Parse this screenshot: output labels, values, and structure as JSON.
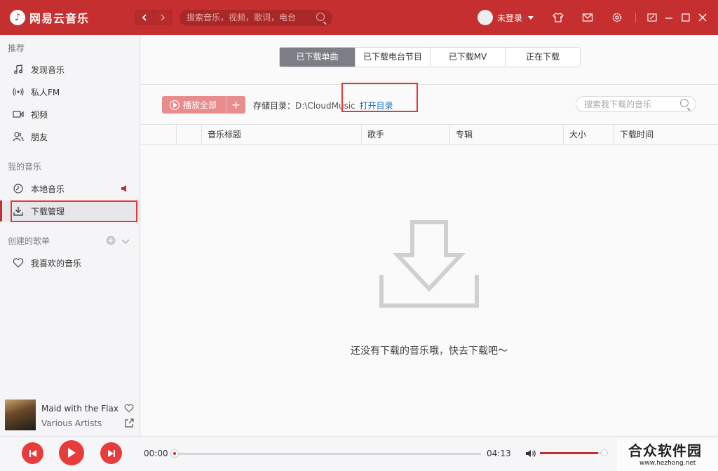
{
  "app": {
    "title": "网易云音乐"
  },
  "titlebar": {
    "search_placeholder": "搜索音乐，视频，歌词，电台",
    "user_label": "未登录"
  },
  "sidebar": {
    "recommend_title": "推荐",
    "recommend_items": [
      {
        "label": "发现音乐",
        "icon": "music-note-icon"
      },
      {
        "label": "私人FM",
        "icon": "radio-icon"
      },
      {
        "label": "视频",
        "icon": "video-icon"
      },
      {
        "label": "朋友",
        "icon": "friends-icon"
      }
    ],
    "my_music_title": "我的音乐",
    "my_music_items": [
      {
        "label": "本地音乐",
        "icon": "clock-icon"
      },
      {
        "label": "下载管理",
        "icon": "download-icon",
        "active": true
      }
    ],
    "created_title": "创建的歌单",
    "created_items": [
      {
        "label": "我喜欢的音乐",
        "icon": "heart-icon"
      }
    ]
  },
  "now_playing": {
    "title": "Maid with the Flax...",
    "artist": "Various Artists"
  },
  "tabs": [
    {
      "label": "已下载单曲",
      "active": true
    },
    {
      "label": "已下载电台节目"
    },
    {
      "label": "已下载MV"
    },
    {
      "label": "正在下载"
    }
  ],
  "toolbar": {
    "play_all": "播放全部",
    "plus": "+",
    "storage_label": "存储目录：",
    "storage_path": "D:\\CloudMusic",
    "open_dir": "打开目录",
    "search_placeholder": "搜索我下载的音乐"
  },
  "table": {
    "headers": [
      "音乐标题",
      "歌手",
      "专辑",
      "大小",
      "下载时间"
    ]
  },
  "empty_message": "还没有下载的音乐哦，快去下载吧～",
  "player": {
    "current_time": "00:00",
    "total_time": "04:13",
    "volume": 0.9
  },
  "watermark": {
    "text": "合众软件园",
    "url": "www.hezhong.net"
  },
  "colors": {
    "brand": "#c62f2f",
    "link": "#0c73c2"
  }
}
